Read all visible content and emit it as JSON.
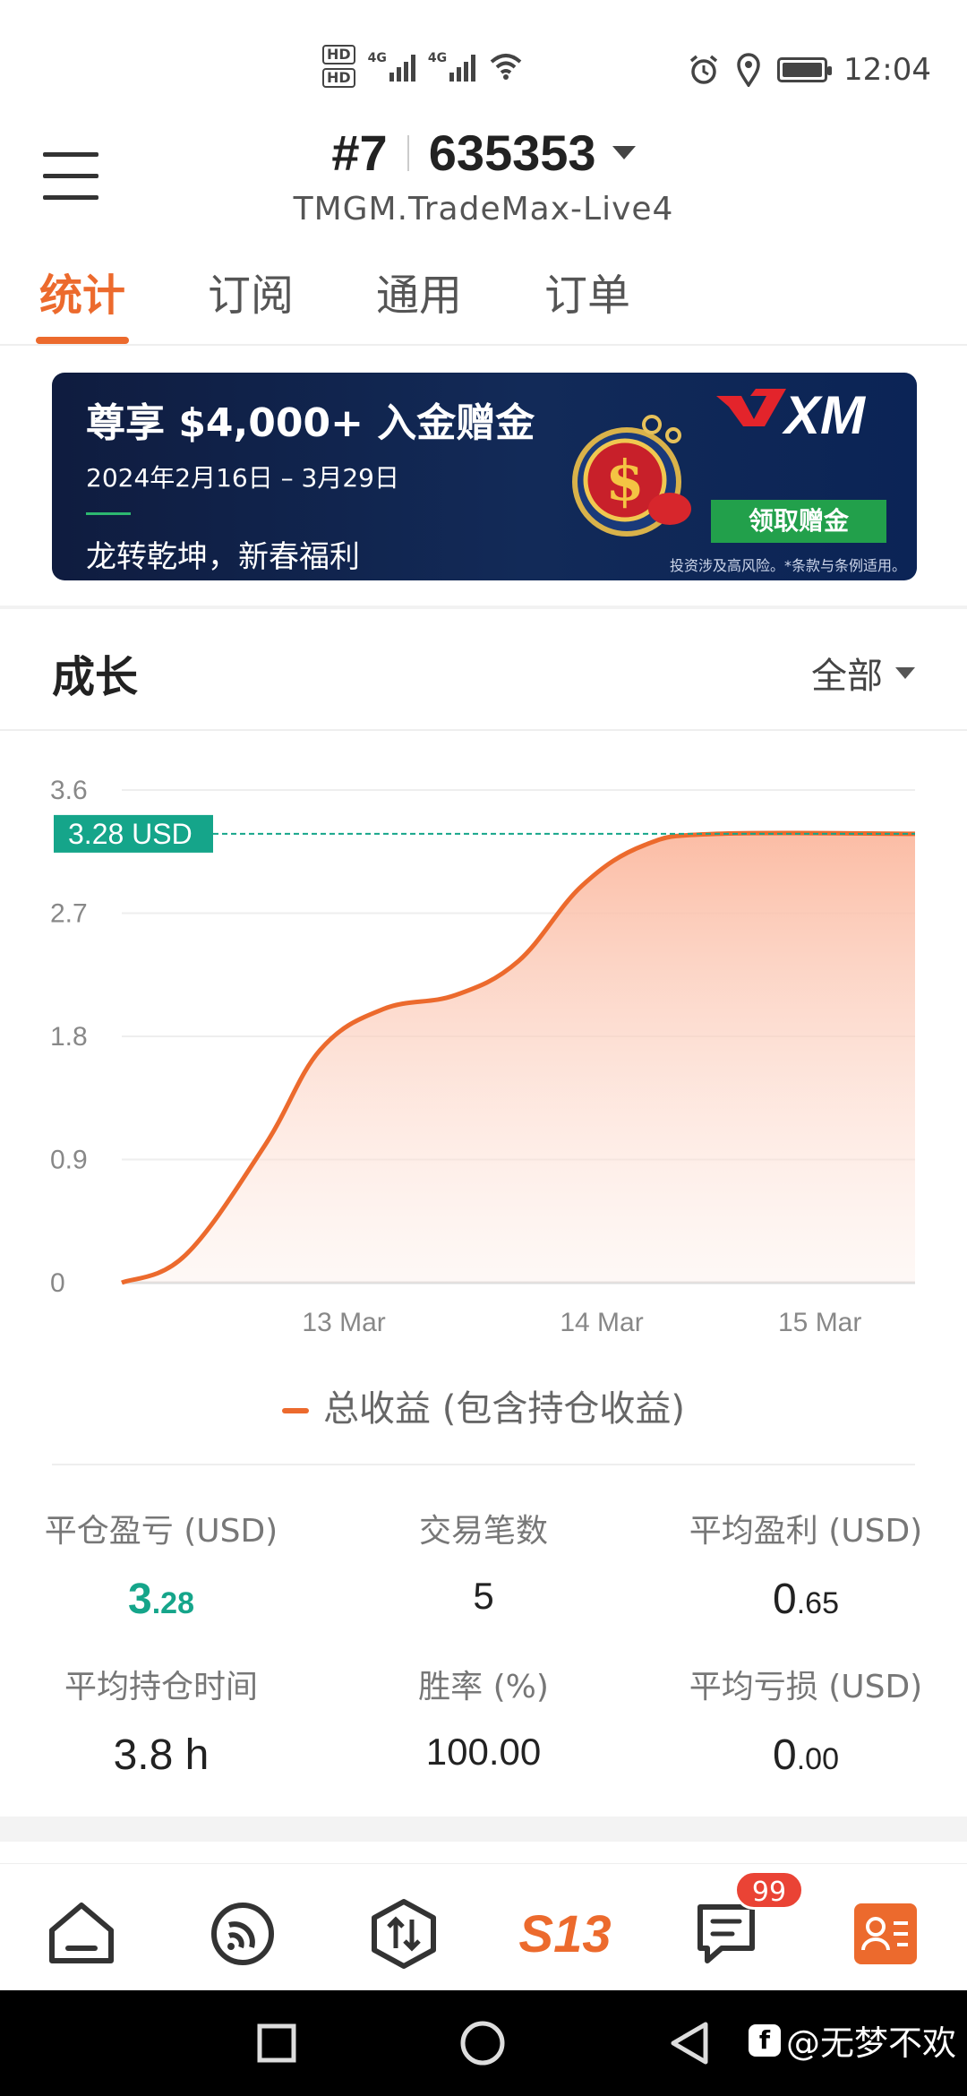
{
  "status_bar": {
    "hd1": "HD",
    "hd2": "HD",
    "net1": "4G",
    "net2": "4G",
    "time": "12:04"
  },
  "header": {
    "account_prefix": "#7",
    "account_number": "635353",
    "server": "TMGM.TradeMax-Live4"
  },
  "tabs": [
    {
      "label": "统计",
      "active": true
    },
    {
      "label": "订阅",
      "active": false
    },
    {
      "label": "通用",
      "active": false
    },
    {
      "label": "订单",
      "active": false
    }
  ],
  "banner": {
    "title": "尊享 $4,000+ 入金赠金",
    "date": "2024年2月16日 – 3月29日",
    "subtitle": "龙转乾坤，新春福利",
    "button": "领取赠金",
    "note": "投资涉及高风险。*条款与条例适用。",
    "brand": "XM"
  },
  "growth": {
    "title": "成长",
    "filter": "全部",
    "current_label": "3.28 USD",
    "legend": "总收益 (包含持仓收益)"
  },
  "chart_data": {
    "type": "area",
    "title": "",
    "xlabel": "",
    "ylabel": "",
    "y_ticks": [
      "0",
      "0.9",
      "1.8",
      "2.7",
      "3.6"
    ],
    "x_ticks": [
      "13 Mar",
      "14 Mar",
      "15 Mar"
    ],
    "ylim": [
      0,
      3.6
    ],
    "current_value": 3.28,
    "series": [
      {
        "name": "总收益 (包含持仓收益)",
        "points": [
          {
            "x": 0.0,
            "y": 0.0
          },
          {
            "x": 0.08,
            "y": 0.2
          },
          {
            "x": 0.18,
            "y": 1.0
          },
          {
            "x": 0.25,
            "y": 1.7
          },
          {
            "x": 0.33,
            "y": 2.0
          },
          {
            "x": 0.42,
            "y": 2.1
          },
          {
            "x": 0.5,
            "y": 2.35
          },
          {
            "x": 0.58,
            "y": 2.9
          },
          {
            "x": 0.66,
            "y": 3.2
          },
          {
            "x": 0.75,
            "y": 3.28
          },
          {
            "x": 1.0,
            "y": 3.28
          }
        ]
      }
    ],
    "colors": {
      "line": "#ec6a2d",
      "fill": "#fbb9a0",
      "marker": "#15a58a",
      "grid": "#eeeeee"
    },
    "grid": true,
    "legend_position": "bottom"
  },
  "stats": [
    {
      "label": "平仓盈亏 (USD)",
      "int": "3",
      "dec": ".28",
      "color": "green"
    },
    {
      "label": "交易笔数",
      "int": "5",
      "dec": "",
      "color": "normal"
    },
    {
      "label": "平均盈利 (USD)",
      "int": "0",
      "dec": ".65",
      "color": "normal"
    },
    {
      "label": "平均持仓时间",
      "int": "3.8 h",
      "dec": "",
      "color": "normal"
    },
    {
      "label": "胜率 (%)",
      "int": "100.00",
      "dec": "",
      "color": "normal"
    },
    {
      "label": "平均亏损 (USD)",
      "int": "0",
      "dec": ".00",
      "color": "normal"
    }
  ],
  "bottom_nav": {
    "items": [
      "home-icon",
      "signal-icon",
      "trade-icon",
      "s13-icon",
      "messages-icon",
      "profile-icon"
    ],
    "s13_text": "S13",
    "badge": "99"
  },
  "watermark": {
    "text": "@无梦不欢"
  }
}
